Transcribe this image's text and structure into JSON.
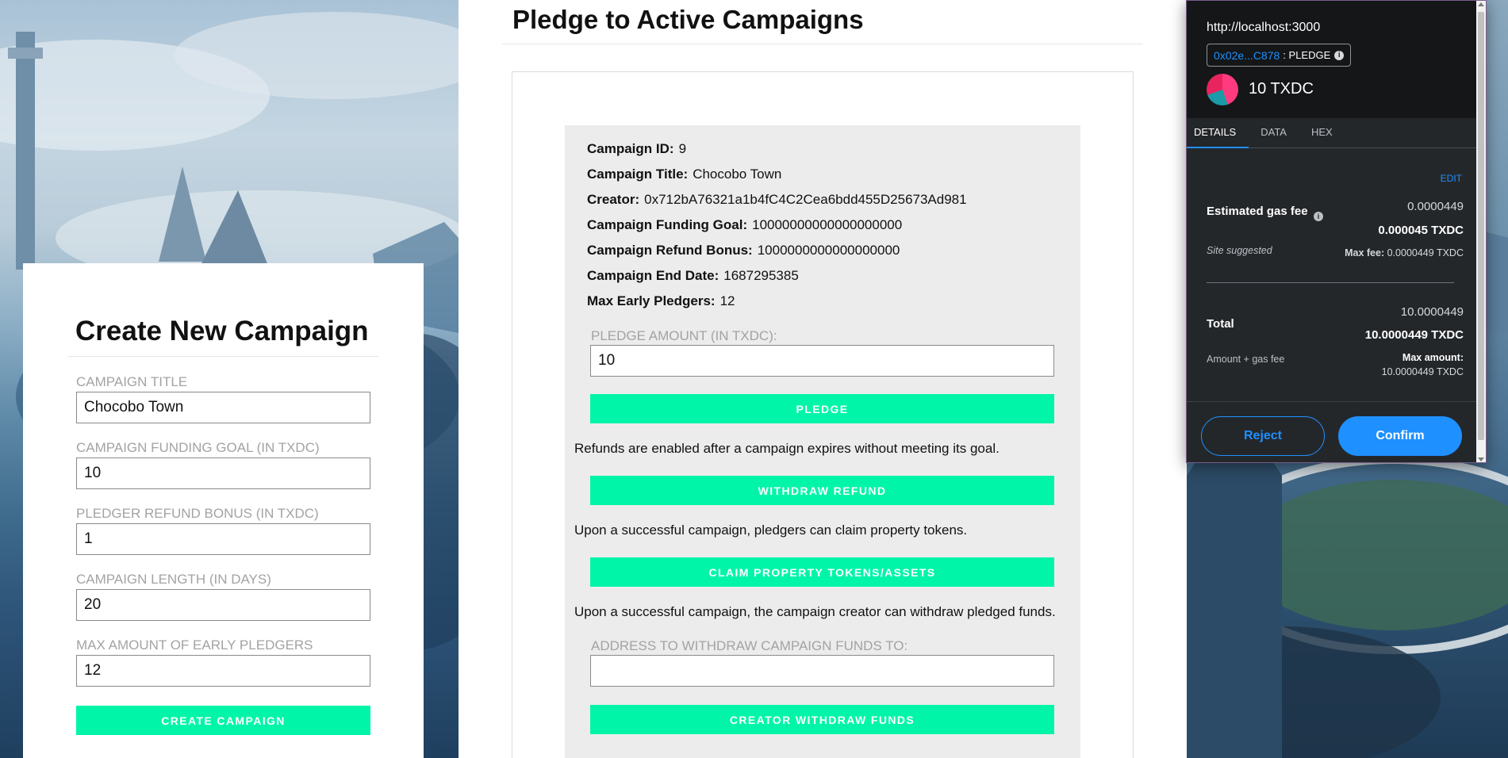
{
  "pledge_page": {
    "title": "Pledge to Active Campaigns",
    "campaign": {
      "id_label": "Campaign ID:",
      "id_value": "9",
      "title_label": "Campaign Title:",
      "title_value": "Chocobo Town",
      "creator_label": "Creator:",
      "creator_value": "0x712bA76321a1b4fC4C2Cea6bdd455D25673Ad981",
      "goal_label": "Campaign Funding Goal:",
      "goal_value": "10000000000000000000",
      "bonus_label": "Campaign Refund Bonus:",
      "bonus_value": "1000000000000000000",
      "end_label": "Campaign End Date:",
      "end_value": "1687295385",
      "early_label": "Max Early Pledgers:",
      "early_value": "12"
    },
    "pledge_amount_label": "PLEDGE AMOUNT (IN TXDC):",
    "pledge_amount_value": "10",
    "pledge_button": "PLEDGE",
    "refund_note": "Refunds are enabled after a campaign expires without meeting its goal.",
    "withdraw_refund_button": "WITHDRAW REFUND",
    "claim_note": "Upon a successful campaign, pledgers can claim property tokens.",
    "claim_button": "CLAIM PROPERTY TOKENS/ASSETS",
    "creator_note": "Upon a successful campaign, the campaign creator can withdraw pledged funds.",
    "withdraw_address_label": "ADDRESS TO WITHDRAW CAMPAIGN FUNDS TO:",
    "withdraw_address_value": "",
    "creator_withdraw_button": "CREATOR WITHDRAW FUNDS"
  },
  "create_form": {
    "title": "Create New Campaign",
    "campaign_title_label": "CAMPAIGN TITLE",
    "campaign_title_value": "Chocobo Town",
    "funding_goal_label": "CAMPAIGN FUNDING GOAL (IN TXDC)",
    "funding_goal_value": "10",
    "refund_bonus_label": "PLEDGER REFUND BONUS (IN TXDC)",
    "refund_bonus_value": "1",
    "length_label": "CAMPAIGN LENGTH (IN DAYS)",
    "length_value": "20",
    "early_label": "MAX AMOUNT OF EARLY PLEDGERS",
    "early_value": "12",
    "create_button": "CREATE CAMPAIGN"
  },
  "wallet": {
    "origin": "http://localhost:3000",
    "account_short": "0x02e...C878",
    "method": ": PLEDGE",
    "amount": "10 TXDC",
    "tabs": [
      "DETAILS",
      "DATA",
      "HEX"
    ],
    "active_tab": "DETAILS",
    "edit": "EDIT",
    "gas_label": "Estimated gas fee",
    "gas_value": "0.0000449",
    "gas_value_bold": "0.000045 TXDC",
    "site_suggested": "Site suggested",
    "max_fee_label": "Max fee:",
    "max_fee_value": "0.0000449 TXDC",
    "total_label": "Total",
    "total_value": "10.0000449",
    "total_value_bold": "10.0000449 TXDC",
    "amount_gas_label": "Amount + gas fee",
    "max_amount_label": "Max amount:",
    "max_amount_value": "10.0000449 TXDC",
    "reject": "Reject",
    "confirm": "Confirm",
    "colors": {
      "accent": "#1e90ff",
      "background": "#24272a"
    }
  },
  "colors": {
    "button_green": "#00f5a8",
    "panel_grey": "#ececec"
  },
  "icons": [
    "info-icon",
    "token-icon"
  ]
}
